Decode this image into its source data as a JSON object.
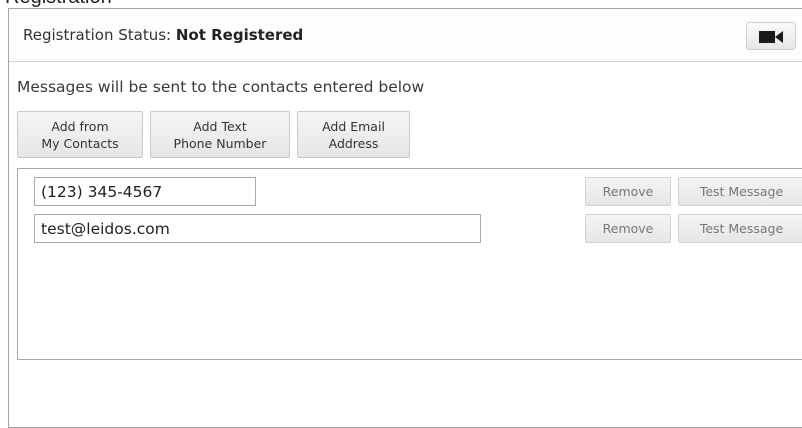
{
  "page_title": "Registration",
  "registration": {
    "status_label": "Registration Status:",
    "status_value": "Not Registered",
    "video_icon": "video-camera-icon"
  },
  "instructions": "Messages will be sent to the contacts entered below",
  "add_buttons": [
    {
      "line1": "Add from",
      "line2": "My Contacts"
    },
    {
      "line1": "Add Text",
      "line2": "Phone Number"
    },
    {
      "line1": "Add Email",
      "line2": "Address"
    }
  ],
  "contacts": [
    {
      "value": "(123) 345-4567",
      "remove_label": "Remove",
      "test_label": "Test Message"
    },
    {
      "value": "test@leidos.com",
      "remove_label": "Remove",
      "test_label": "Test Message"
    }
  ],
  "colors": {
    "border": "#a6a6a6",
    "button_text": "#333333",
    "disabled_text": "#777777"
  }
}
